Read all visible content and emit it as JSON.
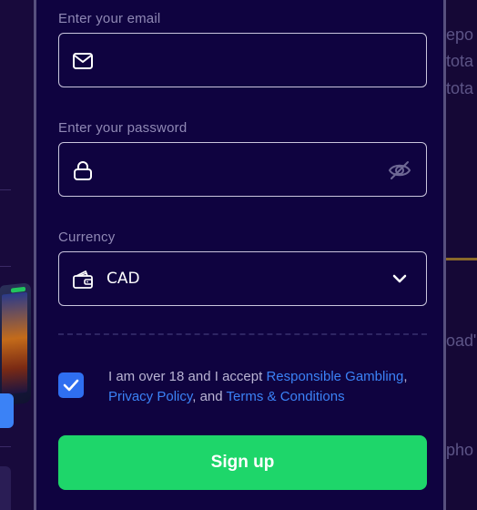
{
  "form": {
    "email": {
      "label": "Enter your email",
      "value": "",
      "icon": "mail-icon"
    },
    "password": {
      "label": "Enter your password",
      "value": "",
      "icon": "lock-icon",
      "toggle_icon": "eye-off-icon"
    },
    "currency": {
      "label": "Currency",
      "selected": "CAD",
      "icon": "wallet-icon",
      "dropdown_icon": "chevron-down-icon"
    },
    "consent": {
      "checked": true,
      "prefix": "I am over 18 and I accept ",
      "link_gambling": "Responsible Gambling",
      "sep1": ",",
      "link_privacy": "Privacy Policy",
      "sep2": ", and ",
      "link_terms": "Terms & Conditions"
    },
    "submit_label": "Sign up"
  },
  "background": {
    "right_fragments": [
      "epo",
      "tota",
      "tota",
      "oad\"",
      "pho"
    ]
  },
  "colors": {
    "modal_bg": "#0f0340",
    "page_bg": "#1a0a40",
    "accent_green": "#1ed66a",
    "link_blue": "#3b82f6",
    "checkbox_blue": "#2f6ff0",
    "label_gray": "#8f88b4"
  }
}
